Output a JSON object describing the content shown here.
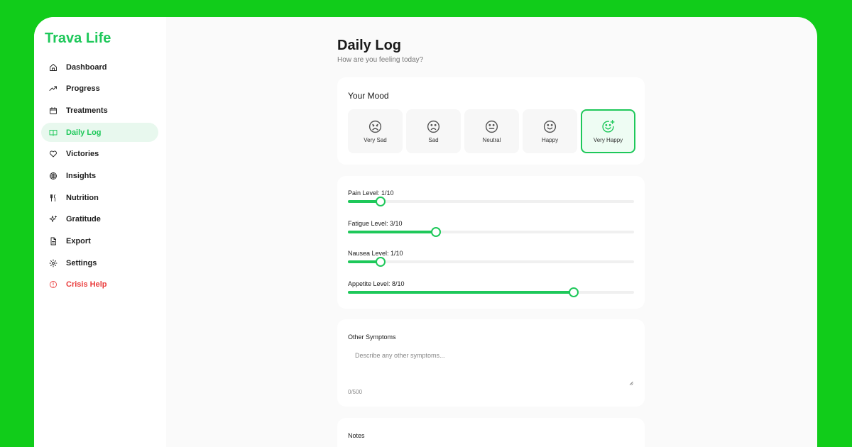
{
  "brand": "Trava Life",
  "nav": [
    {
      "label": "Dashboard",
      "icon": "home-icon"
    },
    {
      "label": "Progress",
      "icon": "trending-up-icon"
    },
    {
      "label": "Treatments",
      "icon": "calendar-icon"
    },
    {
      "label": "Daily Log",
      "icon": "book-open-icon",
      "active": true
    },
    {
      "label": "Victories",
      "icon": "heart-icon"
    },
    {
      "label": "Insights",
      "icon": "brain-icon"
    },
    {
      "label": "Nutrition",
      "icon": "utensils-icon"
    },
    {
      "label": "Gratitude",
      "icon": "sparkles-icon"
    },
    {
      "label": "Export",
      "icon": "file-text-icon"
    },
    {
      "label": "Settings",
      "icon": "gear-icon"
    },
    {
      "label": "Crisis Help",
      "icon": "alert-circle-icon",
      "danger": true
    }
  ],
  "page": {
    "title": "Daily Log",
    "subtitle": "How are you feeling today?"
  },
  "mood": {
    "title": "Your Mood",
    "options": [
      {
        "label": "Very Sad",
        "icon": "very-sad-face-icon"
      },
      {
        "label": "Sad",
        "icon": "sad-face-icon"
      },
      {
        "label": "Neutral",
        "icon": "neutral-face-icon"
      },
      {
        "label": "Happy",
        "icon": "happy-face-icon"
      },
      {
        "label": "Very Happy",
        "icon": "very-happy-face-icon"
      }
    ],
    "selected": "Very Happy"
  },
  "levels": [
    {
      "label": "Pain Level: 1/10",
      "value": 1,
      "max": 10
    },
    {
      "label": "Fatigue Level: 3/10",
      "value": 3,
      "max": 10
    },
    {
      "label": "Nausea Level: 1/10",
      "value": 1,
      "max": 10
    },
    {
      "label": "Appetite Level: 8/10",
      "value": 8,
      "max": 10
    }
  ],
  "symptoms": {
    "label": "Other Symptoms",
    "placeholder": "Describe any other symptoms...",
    "value": "",
    "counter": "0/500"
  },
  "notes": {
    "label": "Notes"
  },
  "colors": {
    "background": "#11cc1a",
    "accent": "#1ec85a",
    "danger": "#ea3b3b",
    "active_nav_bg": "#e8f8ee"
  }
}
